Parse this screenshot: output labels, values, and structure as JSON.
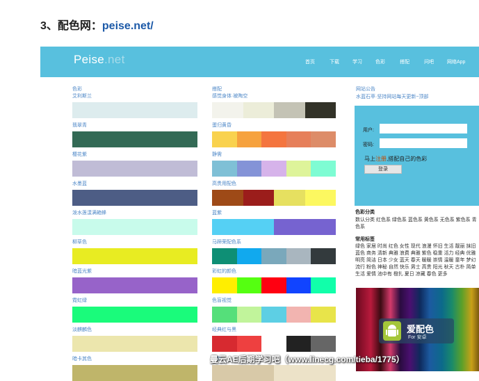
{
  "heading": {
    "prefix": "3、配色网：",
    "link": "peise.net/"
  },
  "site": {
    "logo_main": "Peise",
    "logo_suffix": ".net",
    "nav": [
      "首页",
      "下载",
      "学习",
      "色彩",
      "搭配",
      "问吧",
      "网络App"
    ]
  },
  "left_column": {
    "section_title": "色彩",
    "items": [
      {
        "label": "艾利斯兰",
        "color": "#ddecee"
      },
      {
        "label": "翡翠青",
        "color": "#336a55"
      },
      {
        "label": "樱花紫",
        "color": "#c0bcd6"
      },
      {
        "label": "水墨蓝",
        "color": "#4d5d85"
      },
      {
        "label": "泼水莲漾满箱蜂",
        "color": "#c8fbeb"
      },
      {
        "label": "柳草色",
        "color": "#e8ec22"
      },
      {
        "label": "暗蓝光紫",
        "color": "#9763c9"
      },
      {
        "label": "霓虹绿",
        "color": "#1afb7b"
      },
      {
        "label": "淡麒麟色",
        "color": "#ece6ad"
      },
      {
        "label": "暗卡其色",
        "color": "#bfb56a"
      }
    ]
  },
  "middle_column": {
    "section_title": "搭配",
    "items": [
      {
        "label": "感觉身体·被陶空",
        "colors": [
          "#f3f3ec",
          "#ecedd9",
          "#c4c3b5",
          "#323228"
        ]
      },
      {
        "label": "蛋归黄昏",
        "colors": [
          "#f9d24e",
          "#f6a23e",
          "#f4753f",
          "#e67f5a",
          "#dd8c68"
        ]
      },
      {
        "label": "静需",
        "colors": [
          "#7fc0d6",
          "#8493d7",
          "#d6b3ea",
          "#def49a",
          "#7efcd3"
        ]
      },
      {
        "label": "高贵用配色",
        "colors": [
          "#9e4a17",
          "#9b1d1b",
          "#e6e060",
          "#fcf860"
        ]
      },
      {
        "label": "蓝紫",
        "colors": [
          "#55d0f4",
          "#7663d0"
        ]
      },
      {
        "label": "马蹄荣配色系",
        "colors": [
          "#0e8f75",
          "#11a9ee",
          "#7aa8bb",
          "#a9b6bf",
          "#333a3d"
        ]
      },
      {
        "label": "彩虹的颜色",
        "colors": [
          "#ffee00",
          "#55ff11",
          "#ff0011",
          "#1144ff",
          "#11ffaa"
        ]
      },
      {
        "label": "色盲视觉",
        "colors": [
          "#55df7a",
          "#c1f49b",
          "#5dcfe4",
          "#f2b4b0",
          "#e8e44a"
        ]
      },
      {
        "label": "经典红与黑",
        "colors": [
          "#d72a30",
          "#ee4040",
          "#ffffff",
          "#222222",
          "#666666"
        ]
      },
      {
        "label": "解析",
        "colors": [
          "#d8c9a8",
          "#ece2c8"
        ]
      }
    ]
  },
  "right_column": {
    "announce_title": "网站公告",
    "announce_text": "水蓝石苹·坚持网站每天更新~顶部",
    "login": {
      "user_label": "用户:",
      "pass_label": "密码:",
      "prompt_prefix": "马上",
      "prompt_link": "注册",
      "prompt_suffix": ",搭配自己的色彩",
      "button": "登录"
    },
    "category_title": "色彩分类",
    "categories": "数认分类 红色系 绿色系 蓝色系 黄色系 无色系 紫色系 青色系",
    "tags_title": "常用标签",
    "tags": "绿色 家居 时尚 红色 女性 现代 浪漫 怀旧 生活 靓丽 抹旧 蓝色 商务 清新 典雅 浪费 典雅 紫色 稳重 活力 经典 优雅 明亮 简洁 日本 少女 蓝天 春天 暖暖 崇情 温暖 童年 梦幻 流行 粉色 神秘 自然 快乐 男士 高贵 阳光 秋天 古朴 简单 生活 爱情 池中有 橙扎 夏日 凉藏 春色 更多",
    "ad_title": "爱配色",
    "ad_sub": "For 安卓",
    "ad_icon": "android-icon"
  },
  "watermark": "曼云AE后期学习吧（www.linecg.com/tieba/1775）"
}
